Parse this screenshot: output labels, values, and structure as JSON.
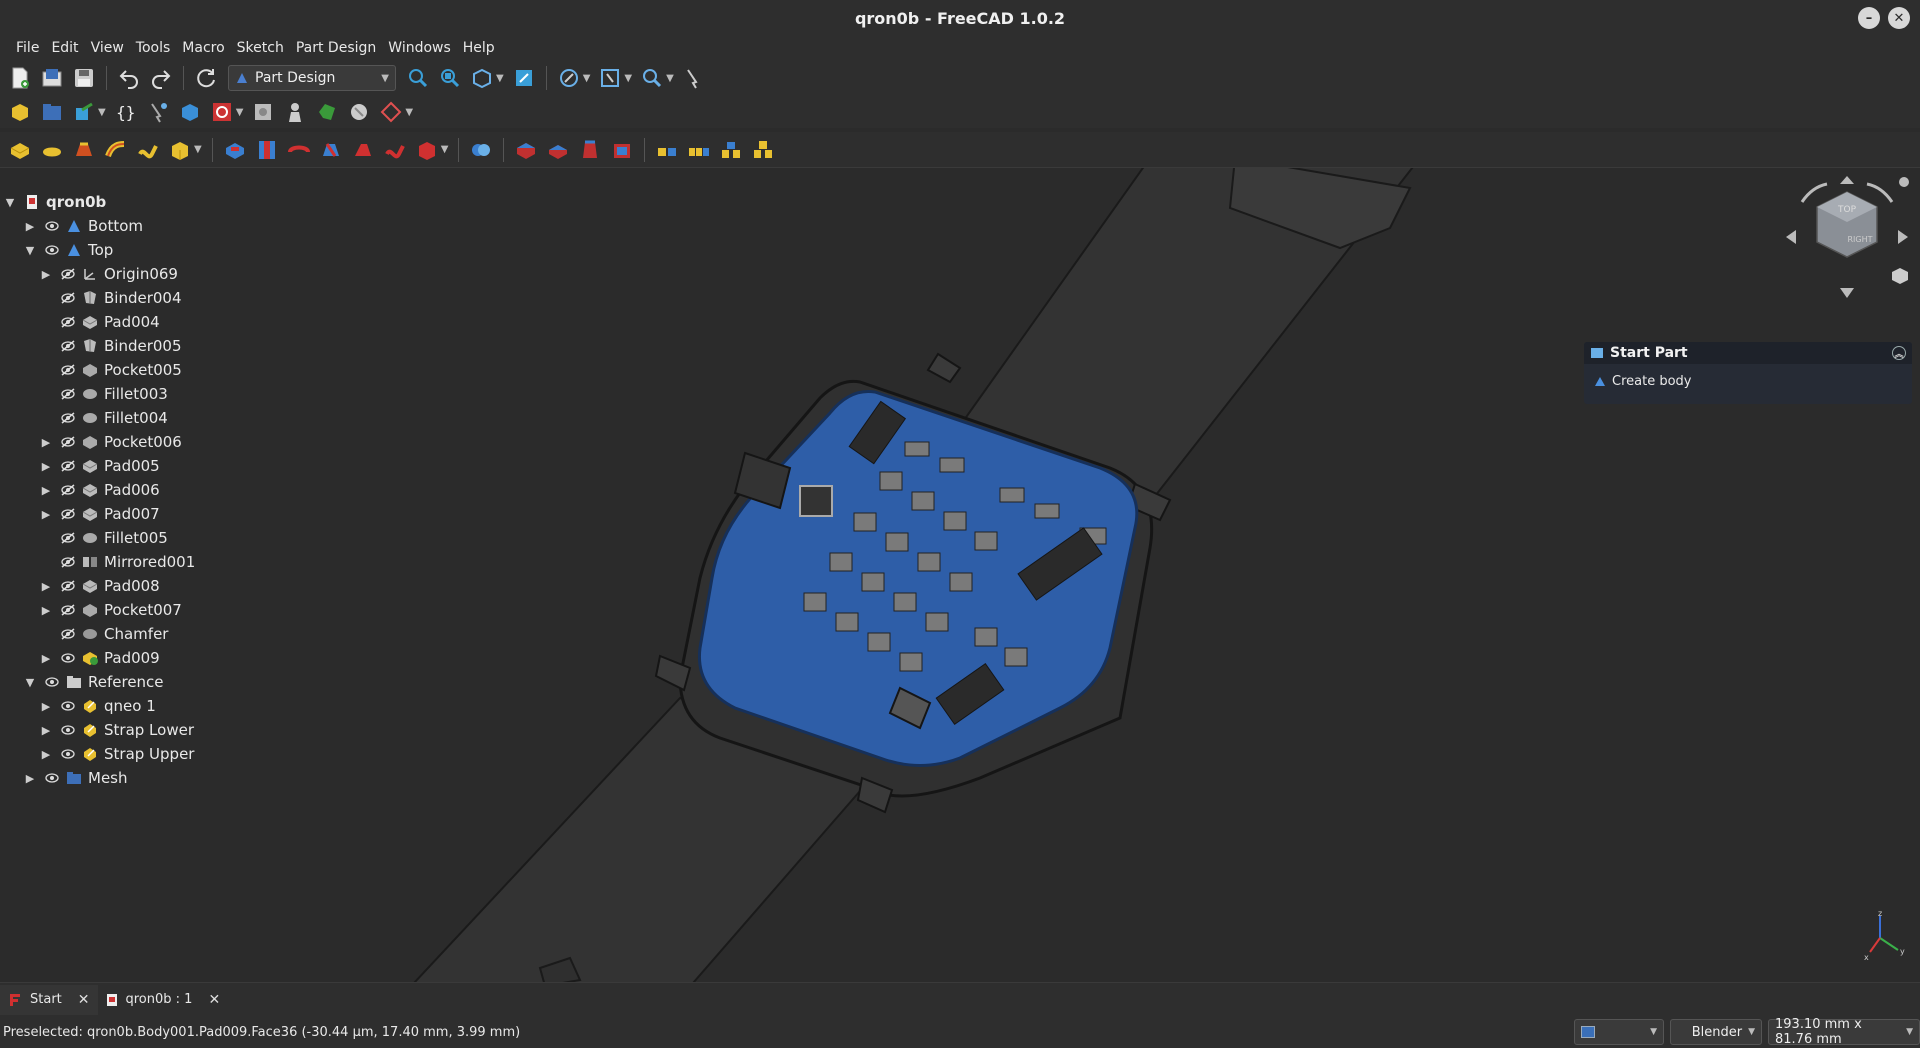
{
  "window": {
    "title": "qron0b - FreeCAD 1.0.2",
    "minimize": "–",
    "close": "✕"
  },
  "menu": [
    "File",
    "Edit",
    "View",
    "Tools",
    "Macro",
    "Sketch",
    "Part Design",
    "Windows",
    "Help"
  ],
  "toolbar": {
    "workbench": "Part Design"
  },
  "tree": {
    "root": "qron0b",
    "items": [
      {
        "label": "Bottom",
        "level": 1,
        "arrow": "▶",
        "icon": "body-icon"
      },
      {
        "label": "Top",
        "level": 1,
        "arrow": "▼",
        "icon": "body-icon"
      },
      {
        "label": "Origin069",
        "level": 2,
        "arrow": "▶",
        "icon": "origin-icon"
      },
      {
        "label": "Binder004",
        "level": 2,
        "arrow": "",
        "icon": "binder-icon"
      },
      {
        "label": "Pad004",
        "level": 2,
        "arrow": "",
        "icon": "pad-icon"
      },
      {
        "label": "Binder005",
        "level": 2,
        "arrow": "",
        "icon": "binder-icon"
      },
      {
        "label": "Pocket005",
        "level": 2,
        "arrow": "",
        "icon": "pocket-icon"
      },
      {
        "label": "Fillet003",
        "level": 2,
        "arrow": "",
        "icon": "fillet-icon"
      },
      {
        "label": "Fillet004",
        "level": 2,
        "arrow": "",
        "icon": "fillet-icon"
      },
      {
        "label": "Pocket006",
        "level": 2,
        "arrow": "▶",
        "icon": "pocket-icon"
      },
      {
        "label": "Pad005",
        "level": 2,
        "arrow": "▶",
        "icon": "pad-icon"
      },
      {
        "label": "Pad006",
        "level": 2,
        "arrow": "▶",
        "icon": "pad-icon"
      },
      {
        "label": "Pad007",
        "level": 2,
        "arrow": "▶",
        "icon": "pad-icon"
      },
      {
        "label": "Fillet005",
        "level": 2,
        "arrow": "",
        "icon": "fillet-icon"
      },
      {
        "label": "Mirrored001",
        "level": 2,
        "arrow": "",
        "icon": "mirrored-icon"
      },
      {
        "label": "Pad008",
        "level": 2,
        "arrow": "▶",
        "icon": "pad-icon"
      },
      {
        "label": "Pocket007",
        "level": 2,
        "arrow": "▶",
        "icon": "pocket-icon"
      },
      {
        "label": "Chamfer",
        "level": 2,
        "arrow": "",
        "icon": "chamfer-icon"
      },
      {
        "label": "Pad009",
        "level": 2,
        "arrow": "▶",
        "icon": "pad-tip-icon"
      },
      {
        "label": "Reference",
        "level": 1,
        "arrow": "▼",
        "icon": "folder-icon"
      },
      {
        "label": "qneo 1",
        "level": 2,
        "arrow": "▶",
        "icon": "link-icon"
      },
      {
        "label": "Strap Lower",
        "level": 2,
        "arrow": "▶",
        "icon": "link-icon"
      },
      {
        "label": "Strap Upper",
        "level": 2,
        "arrow": "▶",
        "icon": "link-icon"
      },
      {
        "label": "Mesh",
        "level": 1,
        "arrow": "▶",
        "icon": "mesh-folder-icon"
      }
    ]
  },
  "task_panel": {
    "title": "Start Part",
    "action": "Create body"
  },
  "tabs": [
    {
      "label": "Start"
    },
    {
      "label": "qron0b : 1"
    }
  ],
  "status": {
    "message": "Preselected: qron0b.Body001.Pad009.Face36 (-30.44 µm, 17.40 mm, 3.99 mm)",
    "nav_style": "Blender",
    "dimensions": "193.10 mm x 81.76 mm"
  },
  "navcube": {
    "faces": [
      "TOP",
      "RIGHT",
      "FRONT"
    ]
  },
  "axis": {
    "x": "x",
    "y": "y",
    "z": "z"
  },
  "colors": {
    "accent_blue": "#2e5ea8",
    "background": "#2b2b2b",
    "panel": "#2e2e2e"
  }
}
